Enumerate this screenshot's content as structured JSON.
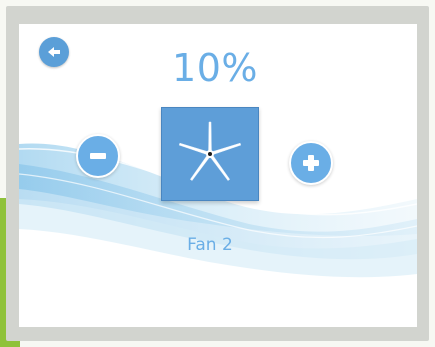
{
  "fan": {
    "level": "10%",
    "name": "Fan 2"
  },
  "icons": {
    "back": "back-arrow-icon",
    "decrease": "minus-icon",
    "increase": "plus-icon",
    "fan": "fan-icon"
  },
  "colors": {
    "accent": "#6aaee6",
    "tile": "#5e9ed8",
    "green_bar": "#8fc23a"
  }
}
